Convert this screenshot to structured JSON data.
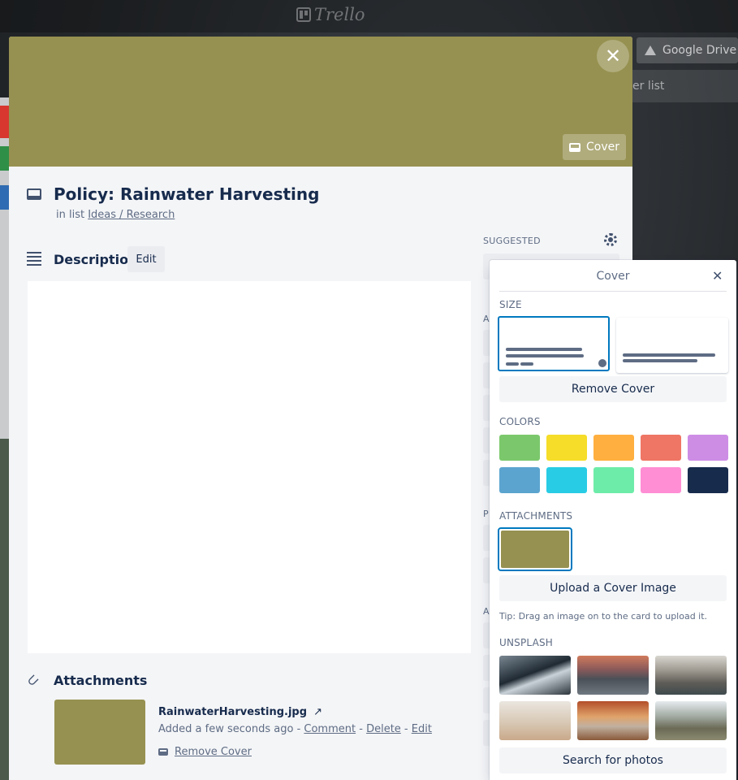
{
  "board": {
    "logo": "Trello",
    "google_drive_label": "Google Drive",
    "add_list_label": "er list"
  },
  "card": {
    "close_icon": "close-icon",
    "cover_button_label": "Cover",
    "cover_color": "#969150",
    "title": "Policy: Rainwater Harvesting",
    "in_list_prefix": "in list",
    "list_name": "Ideas / Research",
    "description": {
      "heading": "Description",
      "edit_label": "Edit"
    },
    "attachments": {
      "heading": "Attachments",
      "file_name": "RainwaterHarvesting.jpg",
      "open_glyph": "↗",
      "added": "Added a few seconds ago",
      "sep1": " - ",
      "comment": "Comment",
      "sep2": " - ",
      "delete": "Delete",
      "sep3": " - ",
      "edit": "Edit",
      "remove_cover": "Remove Cover"
    },
    "sidebar": {
      "suggested": "SUGGESTED",
      "letters": [
        "A",
        "P",
        "A"
      ]
    }
  },
  "cover_popover": {
    "title": "Cover",
    "close_glyph": "✕",
    "size_label": "SIZE",
    "remove_cover": "Remove Cover",
    "colors_label": "COLORS",
    "colors": [
      "#7bc86c",
      "#f5dd29",
      "#ffaf3f",
      "#ef7564",
      "#cd8de5",
      "#5ba4cf",
      "#29cce5",
      "#6deca9",
      "#ff8ed4",
      "#172b4d"
    ],
    "attachments_label": "ATTACHMENTS",
    "upload_label": "Upload a Cover Image",
    "tip": "Tip: Drag an image on to the card to upload it.",
    "unsplash_label": "UNSPLASH",
    "search_photos": "Search for photos"
  }
}
